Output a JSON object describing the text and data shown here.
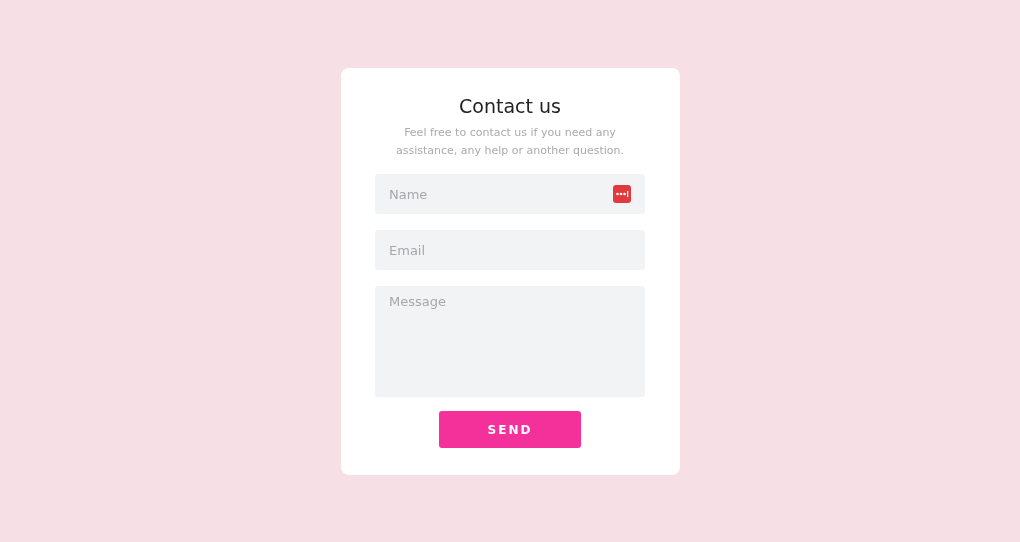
{
  "card": {
    "title": "Contact us",
    "subtitle": "Feel free to contact us if you need any assistance, any help or another question.",
    "fields": [
      {
        "kind": "input",
        "placeholder": "Name",
        "autofill_badge": true
      },
      {
        "kind": "input",
        "placeholder": "Email",
        "autofill_badge": false
      },
      {
        "kind": "textarea",
        "placeholder": "Message",
        "autofill_badge": false
      }
    ],
    "button": "SEND"
  }
}
